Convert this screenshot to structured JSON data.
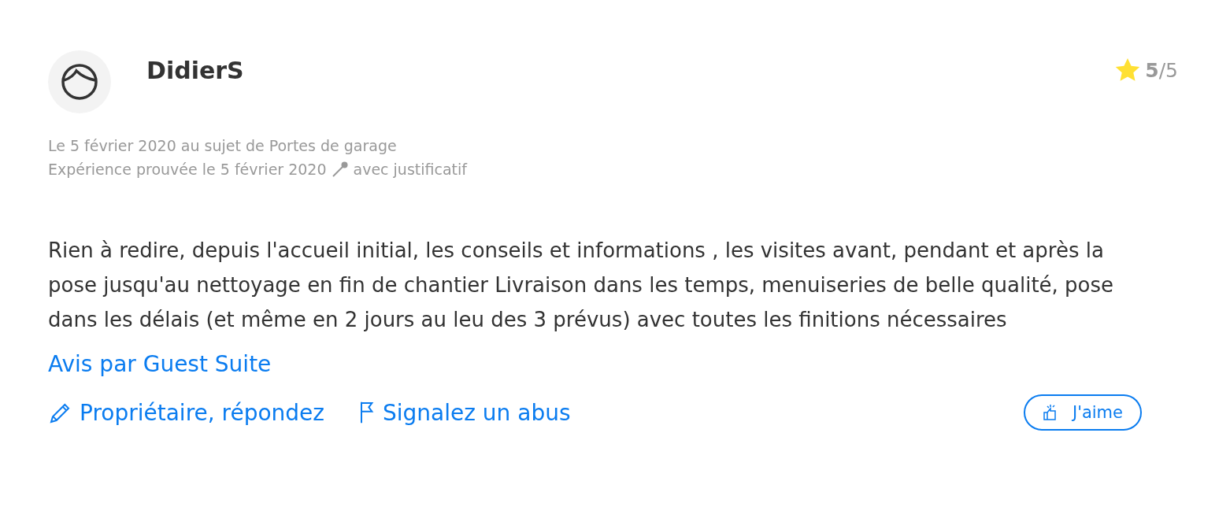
{
  "review": {
    "author": "DidierS",
    "rating": "**5**/5",
    "meta": [
      "Le 5 février 2020 au sujet de Portes de garage",
      "Expérience prouvée le 5 février 2020",
      "avec justificatif"
    ],
    "body": "Rien à redire, depuis l'accueil initial, les conseils et informations , les visites avant, pendant et après la pose jusqu'au nettoyage en fin de chantier Livraison dans les temps, menuiseries de belle qualité, pose dans les délais (et même en 2 jours au leu des 3 prévus) avec toutes les finitions nécessaires",
    "source_link": "Avis par Guest Suite",
    "actions": [
      {
        "kind": "reply",
        "label": "Propriétaire, répondez"
      },
      {
        "kind": "report",
        "label": "Signalez un abus"
      }
    ],
    "like_button": "J'aime"
  }
}
